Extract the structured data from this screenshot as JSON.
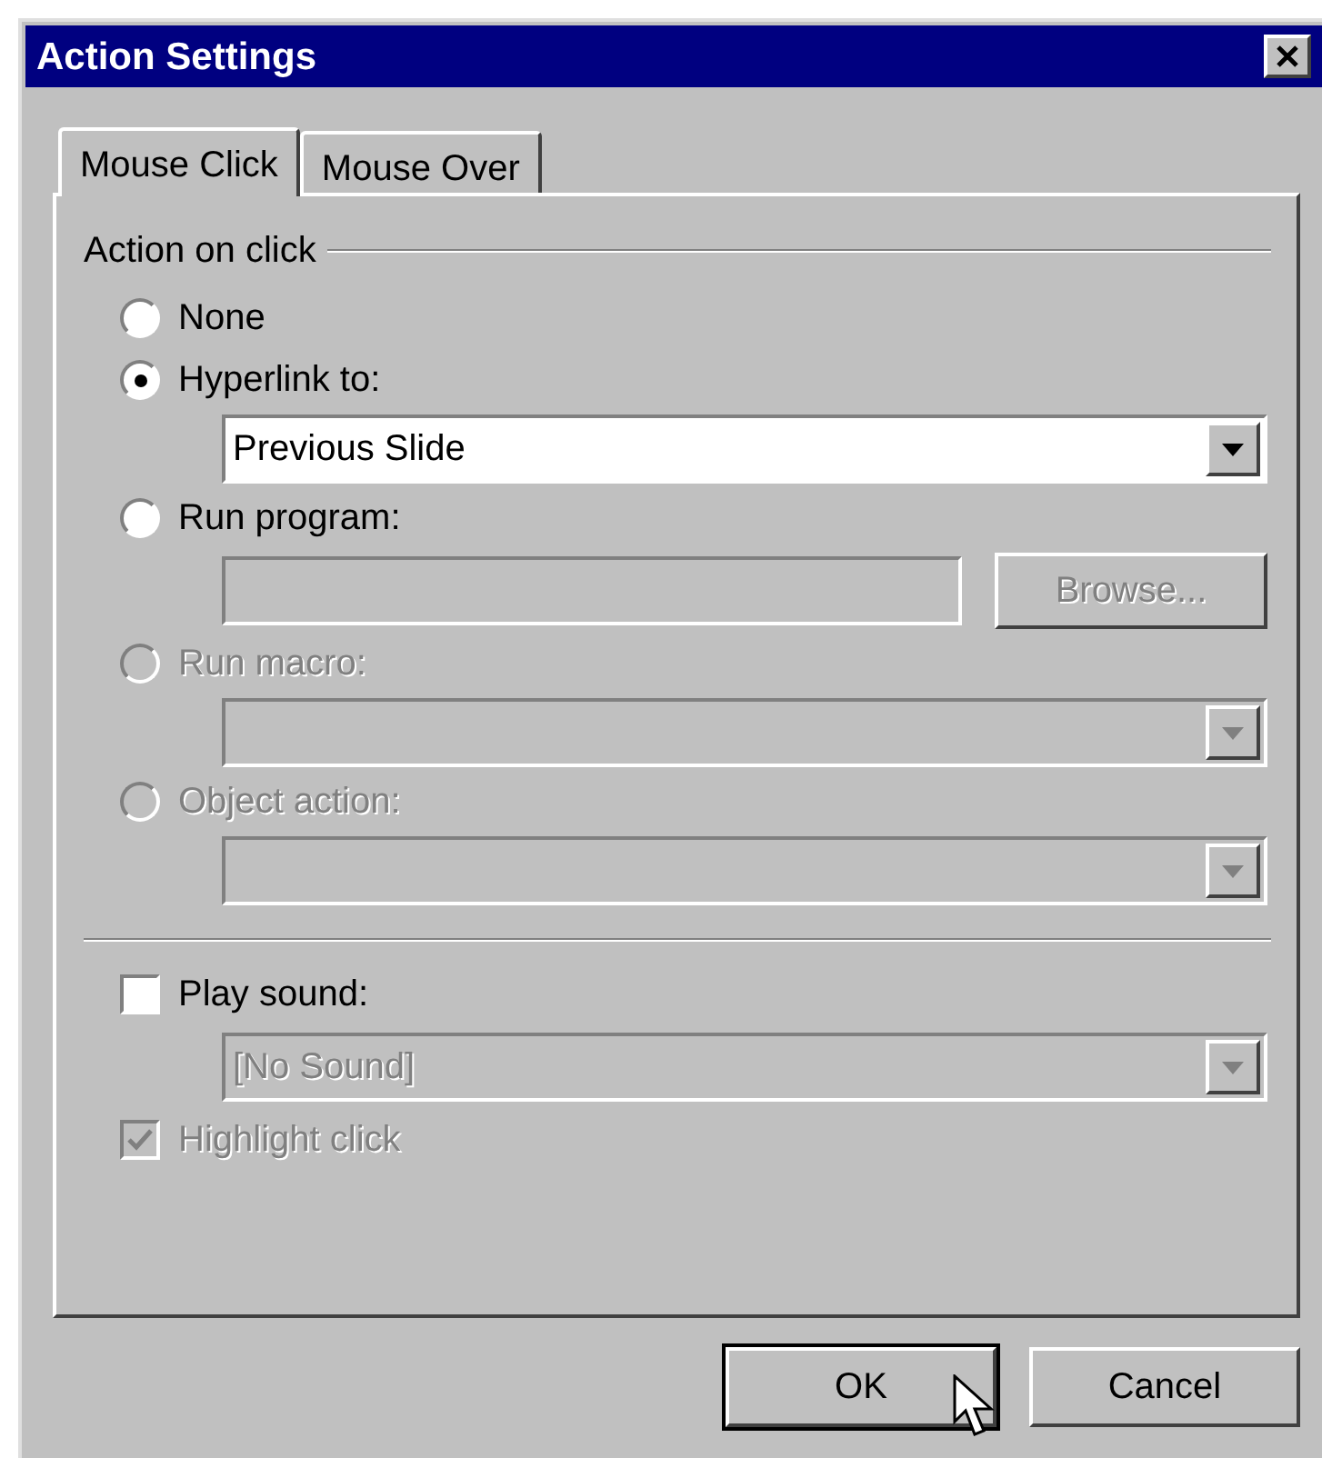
{
  "window": {
    "title": "Action Settings"
  },
  "tabs": [
    {
      "label": "Mouse Click",
      "selected": true
    },
    {
      "label": "Mouse Over",
      "selected": false
    }
  ],
  "group": {
    "title": "Action on click"
  },
  "options": [
    {
      "label": "None",
      "selected": false,
      "disabled": false
    },
    {
      "label": "Hyperlink to:",
      "selected": true,
      "disabled": false,
      "control": {
        "kind": "dropdown",
        "value": "Previous Slide",
        "disabled": false
      }
    },
    {
      "label": "Run program:",
      "selected": false,
      "disabled": false,
      "control": {
        "kind": "text",
        "disabled": true,
        "button": {
          "label": "Browse...",
          "disabled": true
        }
      }
    },
    {
      "label": "Run macro:",
      "selected": false,
      "disabled": true,
      "control": {
        "kind": "dropdown",
        "disabled": true
      }
    },
    {
      "label": "Object action:",
      "selected": false,
      "disabled": true,
      "control": {
        "kind": "dropdown",
        "disabled": true
      }
    }
  ],
  "play_sound": {
    "label": "Play sound:",
    "checked": false,
    "disabled": false,
    "control": {
      "kind": "dropdown",
      "value": "[No Sound]",
      "disabled": true
    }
  },
  "highlight_click": {
    "label": "Highlight click",
    "checked": true,
    "disabled": true
  },
  "buttons": [
    {
      "label": "OK",
      "default": true
    },
    {
      "label": "Cancel",
      "default": false
    }
  ]
}
